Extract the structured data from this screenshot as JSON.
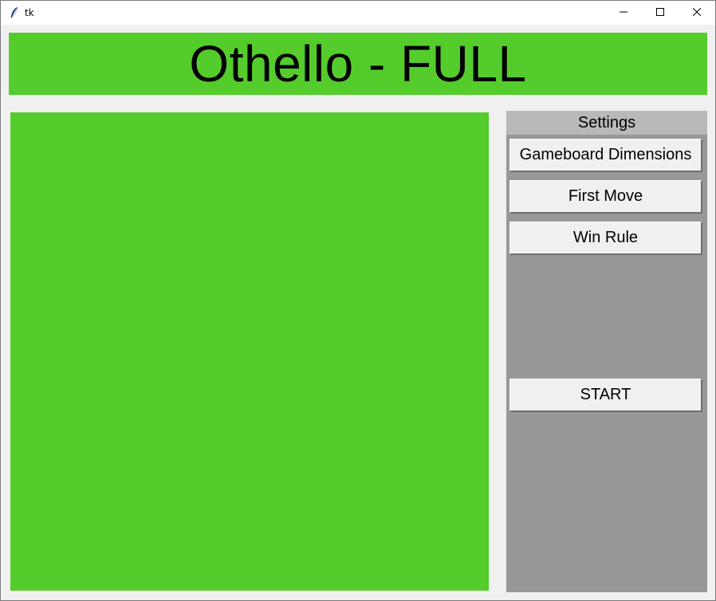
{
  "window": {
    "title": "tk",
    "icons": {
      "app": "feather-icon",
      "minimize": "minimize-icon",
      "maximize": "maximize-icon",
      "close": "close-icon"
    }
  },
  "header": {
    "title": "Othello - FULL",
    "color": "#54cc2c"
  },
  "board": {
    "color": "#54cc2c"
  },
  "settings": {
    "title": "Settings",
    "buttons": {
      "dimensions": "Gameboard Dimensions",
      "first_move": "First Move",
      "win_rule": "Win Rule",
      "start": "START"
    },
    "panel_color": "#989898",
    "title_color": "#b9b9b9"
  }
}
